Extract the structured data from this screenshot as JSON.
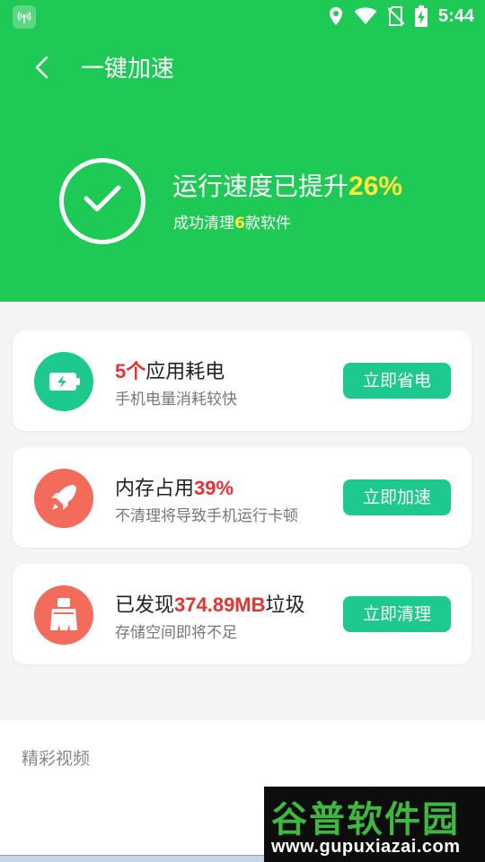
{
  "status_bar": {
    "time": "5:44",
    "icons": [
      "signal-broadcast-icon",
      "location-icon",
      "wifi-icon",
      "no-sim-icon",
      "battery-charging-icon"
    ]
  },
  "header": {
    "title": "一键加速",
    "back_icon": "chevron-left-icon"
  },
  "result": {
    "title_prefix": "运行速度已提升",
    "title_value": "26%",
    "sub_prefix": "成功清理",
    "sub_value": "6",
    "sub_suffix": "款软件"
  },
  "cards": [
    {
      "icon": "battery-icon",
      "title_highlight": "5个",
      "title_rest": "应用耗电",
      "desc": "手机电量消耗较快",
      "button": "立即省电",
      "icon_color": "#1ec98d"
    },
    {
      "icon": "rocket-icon",
      "title_prefix": "内存占用",
      "title_highlight": "39%",
      "desc": "不清理将导致手机运行卡顿",
      "button": "立即加速",
      "icon_color": "#f26b5b"
    },
    {
      "icon": "broom-icon",
      "title_prefix": "已发现",
      "title_highlight": "374.89MB",
      "title_suffix": "垃圾",
      "desc": "存储空间即将不足",
      "button": "立即清理",
      "icon_color": "#f26b5b"
    }
  ],
  "video_section": {
    "label": "精彩视频"
  },
  "watermark": {
    "main": "谷普软件园",
    "url": "www.gupuxiazai.com"
  },
  "colors": {
    "primary_green": "#1ec955",
    "button_green": "#1ec98d",
    "highlight_yellow": "#ffe93a",
    "highlight_red": "#e53232"
  }
}
